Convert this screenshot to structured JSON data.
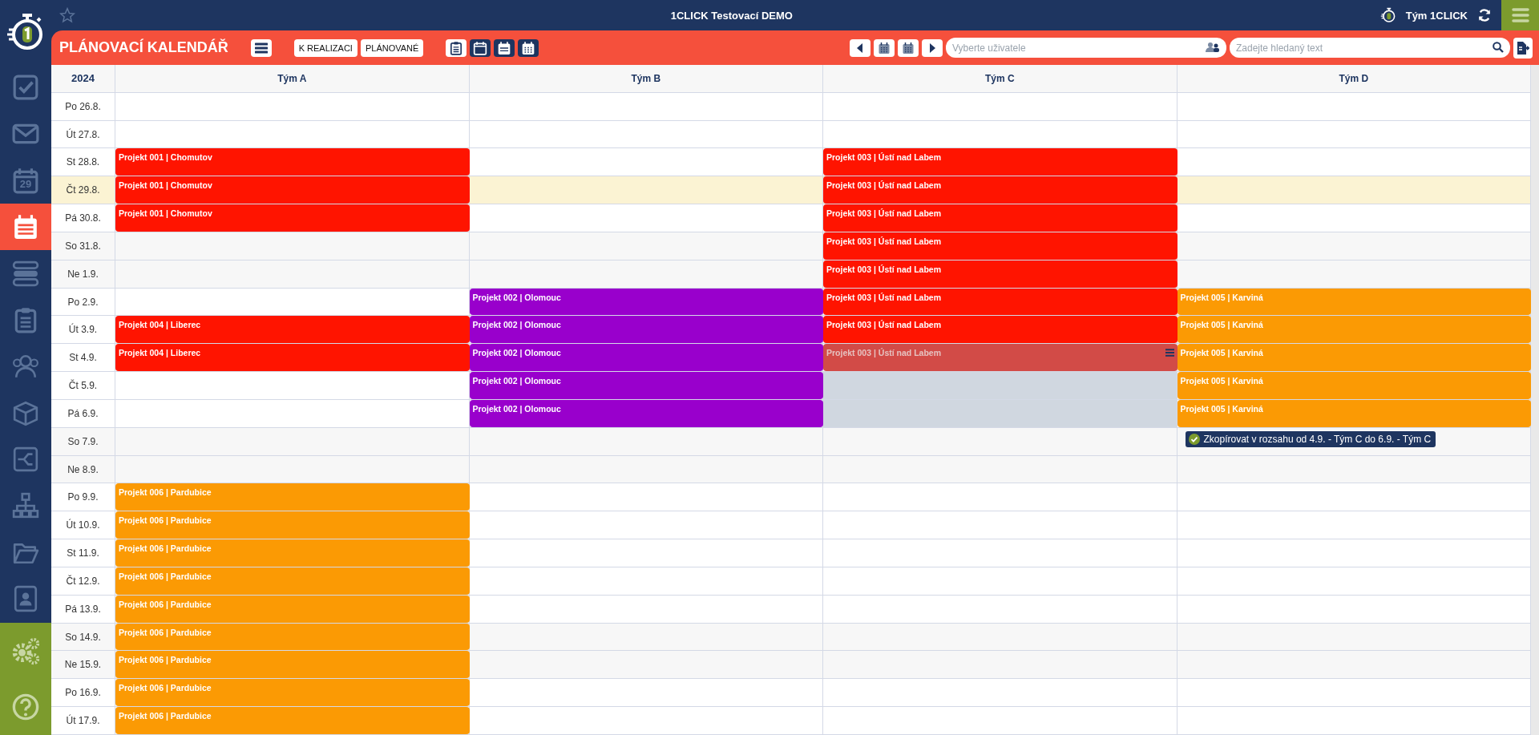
{
  "top_bar": {
    "title": "1CLICK Testovací DEMO",
    "team": "Tým 1CLICK"
  },
  "sidebar": {
    "items": [
      {
        "selected": false
      },
      {
        "selected": false
      },
      {
        "selected": false,
        "badge": "29"
      },
      {
        "selected": true
      },
      {
        "selected": false
      },
      {
        "selected": false
      },
      {
        "selected": false
      },
      {
        "selected": false
      },
      {
        "selected": false
      },
      {
        "selected": false
      },
      {
        "selected": false
      },
      {
        "selected": false
      }
    ]
  },
  "toolbar": {
    "title": "PLÁNOVACÍ KALENDÁŘ",
    "filters": [
      {
        "label": "K REALIZACI"
      },
      {
        "label": "PLÁNOVANÉ"
      }
    ],
    "views": [
      {
        "selected": true
      },
      {
        "selected": false
      },
      {
        "selected": false
      },
      {
        "selected": false
      }
    ],
    "user_field": {
      "placeholder": "Vyberte uživatele"
    },
    "search_field": {
      "placeholder": "Zadejte hledaný text"
    }
  },
  "calendar": {
    "year": "2024",
    "columns": [
      "Tým A",
      "Tým B",
      "Tým C",
      "Tým D"
    ],
    "rows": [
      {
        "date": "Po 26.8.",
        "kind": "weekday",
        "cells": [
          {
            "kind": "empty"
          },
          {
            "kind": "empty"
          },
          {
            "kind": "empty"
          },
          {
            "kind": "empty"
          }
        ]
      },
      {
        "date": "Út 27.8.",
        "kind": "weekday",
        "cells": [
          {
            "kind": "empty"
          },
          {
            "kind": "empty"
          },
          {
            "kind": "empty"
          },
          {
            "kind": "empty"
          }
        ]
      },
      {
        "date": "St 28.8.",
        "kind": "weekday",
        "cells": [
          {
            "kind": "event",
            "text": "Projekt 001 | Chomutov",
            "color": "#ff1400",
            "selected": false
          },
          {
            "kind": "empty"
          },
          {
            "kind": "event",
            "text": "Projekt 003 | Ústí nad Labem",
            "color": "#ff1400",
            "selected": false
          },
          {
            "kind": "empty"
          }
        ]
      },
      {
        "date": "Čt 29.8.",
        "kind": "today",
        "cells": [
          {
            "kind": "event",
            "text": "Projekt 001 | Chomutov",
            "color": "#ff1400",
            "selected": false
          },
          {
            "kind": "empty"
          },
          {
            "kind": "event",
            "text": "Projekt 003 | Ústí nad Labem",
            "color": "#ff1400",
            "selected": false
          },
          {
            "kind": "empty"
          }
        ]
      },
      {
        "date": "Pá 30.8.",
        "kind": "weekday",
        "cells": [
          {
            "kind": "event",
            "text": "Projekt 001 | Chomutov",
            "color": "#ff1400",
            "selected": false
          },
          {
            "kind": "empty"
          },
          {
            "kind": "event",
            "text": "Projekt 003 | Ústí nad Labem",
            "color": "#ff1400",
            "selected": false
          },
          {
            "kind": "empty"
          }
        ]
      },
      {
        "date": "So 31.8.",
        "kind": "weekend",
        "cells": [
          {
            "kind": "empty"
          },
          {
            "kind": "empty"
          },
          {
            "kind": "event",
            "text": "Projekt 003 | Ústí nad Labem",
            "color": "#ff1400",
            "selected": false
          },
          {
            "kind": "empty"
          }
        ]
      },
      {
        "date": "Ne 1.9.",
        "kind": "weekend",
        "cells": [
          {
            "kind": "empty"
          },
          {
            "kind": "empty"
          },
          {
            "kind": "event",
            "text": "Projekt 003 | Ústí nad Labem",
            "color": "#ff1400",
            "selected": false
          },
          {
            "kind": "empty"
          }
        ]
      },
      {
        "date": "Po 2.9.",
        "kind": "weekday",
        "cells": [
          {
            "kind": "empty"
          },
          {
            "kind": "event",
            "text": "Projekt 002 | Olomouc",
            "color": "#9900cc",
            "selected": false
          },
          {
            "kind": "event",
            "text": "Projekt 003 | Ústí nad Labem",
            "color": "#ff1400",
            "selected": false
          },
          {
            "kind": "event",
            "text": "Projekt 005 | Karviná",
            "color": "#fb9a04",
            "selected": false
          }
        ]
      },
      {
        "date": "Út 3.9.",
        "kind": "weekday",
        "cells": [
          {
            "kind": "event",
            "text": "Projekt 004 | Liberec",
            "color": "#ff1400",
            "selected": false
          },
          {
            "kind": "event",
            "text": "Projekt 002 | Olomouc",
            "color": "#9900cc",
            "selected": false
          },
          {
            "kind": "event",
            "text": "Projekt 003 | Ústí nad Labem",
            "color": "#ff1400",
            "selected": false
          },
          {
            "kind": "event",
            "text": "Projekt 005 | Karviná",
            "color": "#fb9a04",
            "selected": false
          }
        ]
      },
      {
        "date": "St 4.9.",
        "kind": "weekday",
        "cells": [
          {
            "kind": "event",
            "text": "Projekt 004 | Liberec",
            "color": "#ff1400",
            "selected": false
          },
          {
            "kind": "event",
            "text": "Projekt 002 | Olomouc",
            "color": "#9900cc",
            "selected": false
          },
          {
            "kind": "event",
            "text": "Projekt 003 | Ústí nad Labem",
            "color": "#d24b47",
            "selected": true
          },
          {
            "kind": "event",
            "text": "Projekt 005 | Karviná",
            "color": "#fb9a04",
            "selected": false
          }
        ]
      },
      {
        "date": "Čt 5.9.",
        "kind": "weekday",
        "cells": [
          {
            "kind": "empty"
          },
          {
            "kind": "event",
            "text": "Projekt 002 | Olomouc",
            "color": "#9900cc",
            "selected": false
          },
          {
            "kind": "range"
          },
          {
            "kind": "event",
            "text": "Projekt 005 | Karviná",
            "color": "#fb9a04",
            "selected": false
          }
        ]
      },
      {
        "date": "Pá 6.9.",
        "kind": "weekday",
        "cells": [
          {
            "kind": "empty"
          },
          {
            "kind": "event",
            "text": "Projekt 002 | Olomouc",
            "color": "#9900cc",
            "selected": false
          },
          {
            "kind": "range"
          },
          {
            "kind": "event",
            "text": "Projekt 005 | Karviná",
            "color": "#fb9a04",
            "selected": false
          }
        ]
      },
      {
        "date": "So 7.9.",
        "kind": "weekend",
        "cells": [
          {
            "kind": "empty"
          },
          {
            "kind": "empty"
          },
          {
            "kind": "empty"
          },
          {
            "kind": "empty",
            "tooltip": "Zkopírovat v rozsahu od 4.9. - Tým C do 6.9. - Tým C"
          }
        ]
      },
      {
        "date": "Ne 8.9.",
        "kind": "weekend",
        "cells": [
          {
            "kind": "empty"
          },
          {
            "kind": "empty"
          },
          {
            "kind": "empty"
          },
          {
            "kind": "empty"
          }
        ]
      },
      {
        "date": "Po 9.9.",
        "kind": "weekday",
        "cells": [
          {
            "kind": "event",
            "text": "Projekt 006 | Pardubice",
            "color": "#fb9a04",
            "selected": false
          },
          {
            "kind": "empty"
          },
          {
            "kind": "empty"
          },
          {
            "kind": "empty"
          }
        ]
      },
      {
        "date": "Út 10.9.",
        "kind": "weekday",
        "cells": [
          {
            "kind": "event",
            "text": "Projekt 006 | Pardubice",
            "color": "#fb9a04",
            "selected": false
          },
          {
            "kind": "empty"
          },
          {
            "kind": "empty"
          },
          {
            "kind": "empty"
          }
        ]
      },
      {
        "date": "St 11.9.",
        "kind": "weekday",
        "cells": [
          {
            "kind": "event",
            "text": "Projekt 006 | Pardubice",
            "color": "#fb9a04",
            "selected": false
          },
          {
            "kind": "empty"
          },
          {
            "kind": "empty"
          },
          {
            "kind": "empty"
          }
        ]
      },
      {
        "date": "Čt 12.9.",
        "kind": "weekday",
        "cells": [
          {
            "kind": "event",
            "text": "Projekt 006 | Pardubice",
            "color": "#fb9a04",
            "selected": false
          },
          {
            "kind": "empty"
          },
          {
            "kind": "empty"
          },
          {
            "kind": "empty"
          }
        ]
      },
      {
        "date": "Pá 13.9.",
        "kind": "weekday",
        "cells": [
          {
            "kind": "event",
            "text": "Projekt 006 | Pardubice",
            "color": "#fb9a04",
            "selected": false
          },
          {
            "kind": "empty"
          },
          {
            "kind": "empty"
          },
          {
            "kind": "empty"
          }
        ]
      },
      {
        "date": "So 14.9.",
        "kind": "weekend",
        "cells": [
          {
            "kind": "event",
            "text": "Projekt 006 | Pardubice",
            "color": "#fb9a04",
            "selected": false
          },
          {
            "kind": "empty"
          },
          {
            "kind": "empty"
          },
          {
            "kind": "empty"
          }
        ]
      },
      {
        "date": "Ne 15.9.",
        "kind": "weekend",
        "cells": [
          {
            "kind": "event",
            "text": "Projekt 006 | Pardubice",
            "color": "#fb9a04",
            "selected": false
          },
          {
            "kind": "empty"
          },
          {
            "kind": "empty"
          },
          {
            "kind": "empty"
          }
        ]
      },
      {
        "date": "Po 16.9.",
        "kind": "weekday",
        "cells": [
          {
            "kind": "event",
            "text": "Projekt 006 | Pardubice",
            "color": "#fb9a04",
            "selected": false
          },
          {
            "kind": "empty"
          },
          {
            "kind": "empty"
          },
          {
            "kind": "empty"
          }
        ]
      },
      {
        "date": "Út 17.9.",
        "kind": "weekday",
        "cells": [
          {
            "kind": "event",
            "text": "Projekt 006 | Pardubice",
            "color": "#fb9a04",
            "selected": false
          },
          {
            "kind": "empty"
          },
          {
            "kind": "empty"
          },
          {
            "kind": "empty"
          }
        ]
      }
    ]
  }
}
